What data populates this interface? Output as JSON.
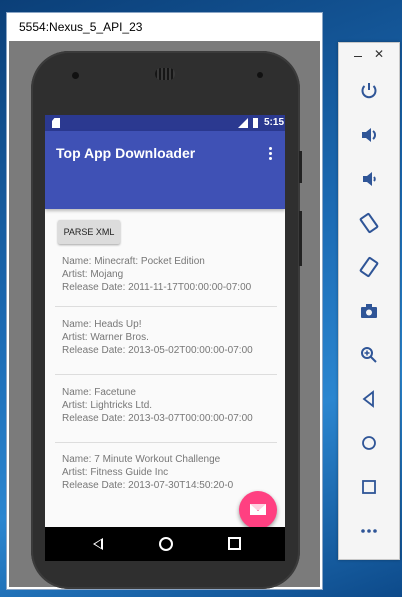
{
  "emulator": {
    "window_title": "5554:Nexus_5_API_23"
  },
  "status_bar": {
    "time": "5:15"
  },
  "app": {
    "title": "Top App Downloader",
    "parse_button_label": "PARSE XML",
    "items": [
      {
        "name": "Name: Minecraft: Pocket Edition",
        "artist": "Artist: Mojang",
        "release": "Release Date: 2011-11-17T00:00:00-07:00"
      },
      {
        "name": "Name: Heads Up!",
        "artist": "Artist: Warner Bros.",
        "release": "Release Date: 2013-05-02T00:00:00-07:00"
      },
      {
        "name": "Name: Facetune",
        "artist": "Artist: Lightricks Ltd.",
        "release": "Release Date: 2013-03-07T00:00:00-07:00"
      },
      {
        "name": "Name: 7 Minute Workout Challenge",
        "artist": "Artist: Fitness Guide Inc",
        "release": "Release Date: 2013-07-30T14:50:20-0"
      }
    ]
  },
  "toolbar": {
    "close_glyph": "✕",
    "buttons": [
      "power-icon",
      "volume-up-icon",
      "volume-down-icon",
      "rotate-left-icon",
      "rotate-right-icon",
      "camera-icon",
      "zoom-icon",
      "back-icon",
      "home-icon",
      "overview-icon",
      "more-icon"
    ]
  },
  "colors": {
    "primary": "#3f51b5",
    "status_bar": "#2b3990",
    "fab": "#ff4081",
    "toolbar_icon": "#2f5597"
  }
}
